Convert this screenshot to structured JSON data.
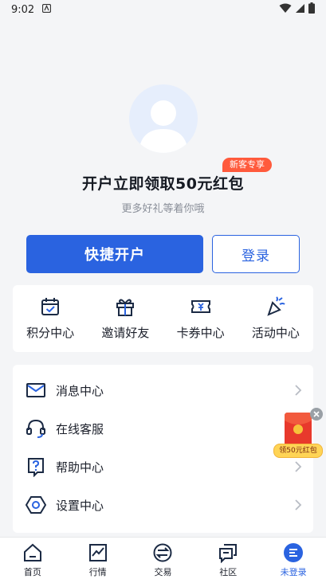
{
  "status_bar": {
    "time": "9:02"
  },
  "profile": {
    "promo_badge": "新客专享",
    "promo_title": "开户立即领取50元红包",
    "promo_subtitle": "更多好礼等着你哦"
  },
  "actions": {
    "open_account": "快捷开户",
    "login": "登录"
  },
  "quick_links": [
    {
      "label": "积分中心",
      "icon": "calendar-check-icon"
    },
    {
      "label": "邀请好友",
      "icon": "gift-icon"
    },
    {
      "label": "卡券中心",
      "icon": "coupon-icon"
    },
    {
      "label": "活动中心",
      "icon": "party-popper-icon"
    }
  ],
  "menu": [
    {
      "label": "消息中心",
      "icon": "mail-icon"
    },
    {
      "label": "在线客服",
      "icon": "headset-icon"
    },
    {
      "label": "帮助中心",
      "icon": "help-icon"
    },
    {
      "label": "设置中心",
      "icon": "settings-icon"
    }
  ],
  "floating_promo": {
    "label": "领50元红包"
  },
  "tabbar": [
    {
      "label": "首页",
      "icon": "home-icon",
      "active": false
    },
    {
      "label": "行情",
      "icon": "chart-icon",
      "active": false
    },
    {
      "label": "交易",
      "icon": "exchange-icon",
      "active": false
    },
    {
      "label": "社区",
      "icon": "community-icon",
      "active": false
    },
    {
      "label": "未登录",
      "icon": "account-icon",
      "active": true
    }
  ],
  "colors": {
    "primary": "#2a63e0",
    "badge": "#ff5a3c",
    "background": "#f4f5f7"
  }
}
